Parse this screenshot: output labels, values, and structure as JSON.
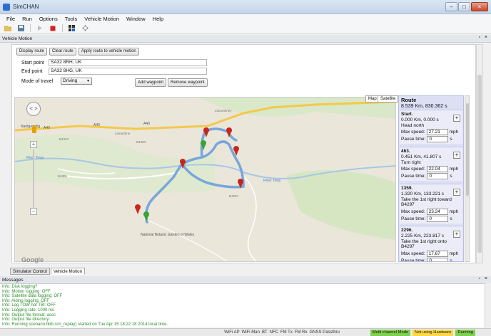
{
  "window": {
    "title": "SimCHAN",
    "minimize": "–",
    "maximize": "□",
    "close": "×"
  },
  "menu": [
    "File",
    "Run",
    "Options",
    "Tools",
    "Vehicle Motion",
    "Window",
    "Help"
  ],
  "toolbar_icons": [
    "open-folder-icon",
    "save-icon",
    "play-icon",
    "stop-icon",
    "cluster-icon",
    "move-icon"
  ],
  "dock": {
    "title": "Vehicle Motion",
    "controls": "▫ ×"
  },
  "route_buttons": {
    "display": "Display route",
    "clear": "Clear route",
    "apply": "Apply route to vehicle motion"
  },
  "form": {
    "start_label": "Start point",
    "start_value": "SA32 8RH, UK",
    "end_label": "End point",
    "end_value": "SA32 8HG, UK",
    "mode_label": "Mode of travel",
    "mode_value": "Driving",
    "add_waypoint": "Add waypoint",
    "remove_waypoint": "Remove waypoint"
  },
  "map": {
    "type_map": "Map",
    "type_satellite": "Satellite",
    "zoom_in": "+",
    "zoom_out": "–",
    "pan": "< >",
    "logo": "Google",
    "labels": {
      "A40_1": "A40",
      "A40_2": "A40",
      "A40_3": "A40",
      "llanarthne": "Llanarthne",
      "nantgaredig": "Nantgaredig",
      "b4310": "B4310",
      "b4300": "B4300",
      "b4300_2": "B4300",
      "b4297": "B4297",
      "river_towy": "River Towy",
      "river_towy_2": "River Towy",
      "garden": "National Botanic\nGarden of Wales",
      "llanarthney": "Llanarthney"
    }
  },
  "route": {
    "title": "Route",
    "summary": "8.539 Km, 830.362 s",
    "max_speed_label": "Max speed:",
    "pause_label": "Pause time:",
    "unit_speed": "mph",
    "unit_time": "s",
    "steps": [
      {
        "id": "Start.",
        "dist": "0.000 Km, 0.000 s",
        "instr": "Head north",
        "speed": "27.21",
        "pause": "0"
      },
      {
        "id": "463.",
        "dist": "0.451 Km, 41.807 s",
        "instr": "Turn right",
        "speed": "22.04",
        "pause": "0"
      },
      {
        "id": "1359.",
        "dist": "1.320 Km, 133.221 s",
        "instr": "Take the 1st right toward B4297",
        "speed": "23.24",
        "pause": "0"
      },
      {
        "id": "2296.",
        "dist": "2.225 Km, 223.817 s",
        "instr": "Take the 1st right onto B4297",
        "speed": "17.67",
        "pause": "0"
      }
    ]
  },
  "tabs": [
    "Simulator Control",
    "Vehicle Motion"
  ],
  "messages_title": "Messages",
  "messages": [
    "Info: Disk logging?",
    "Info: Motion logging: OFF",
    "Info: Satellite data logging: OFF",
    "Info: Aiding logging: OFF",
    "Info: Log TOW not TBI: OFF",
    "Info: Logging rate: 1000 ms",
    "Info: Output file format: ascii",
    "Info: Output file directory:",
    "Info: Running scenario bbb.scn_replay) started on Tue Apr 15 18:22:18 2014 local time."
  ],
  "status": {
    "items": [
      "WiFi AP",
      "WiFi Man",
      "BT",
      "NFC",
      "FM Tx",
      "FM Rx",
      "GNSS Passthru"
    ],
    "badges": [
      {
        "label": "Multi channel Mode",
        "color": "#7fd04f"
      },
      {
        "label": "Not using Hardware",
        "color": "#ffd84a"
      },
      {
        "label": "Running",
        "color": "#7fd04f"
      }
    ]
  }
}
